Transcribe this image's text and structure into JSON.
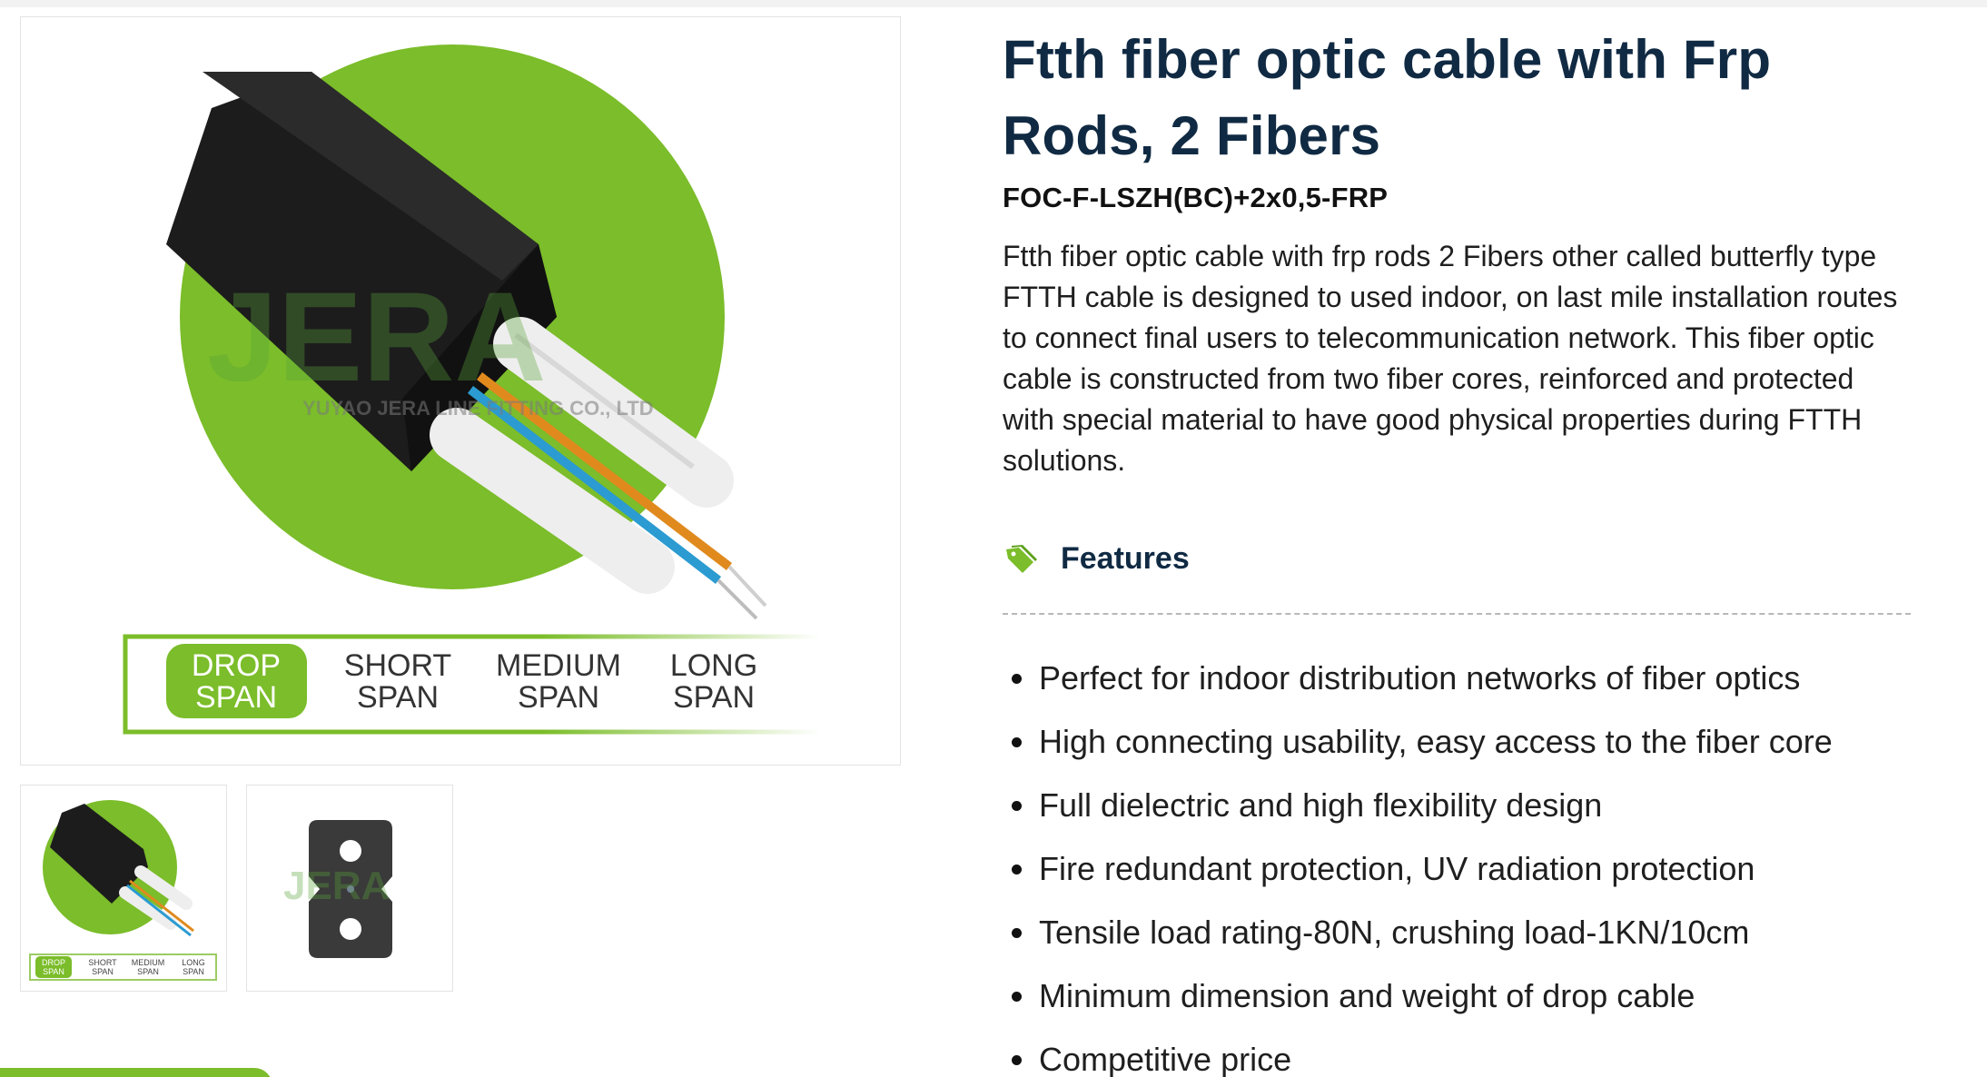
{
  "product": {
    "title": "Ftth fiber optic cable with Frp Rods, 2 Fibers",
    "model": "FOC-F-LSZH(BC)+2x0,5-FRP",
    "description": "Ftth fiber optic cable with frp rods 2 Fibers other called butterfly type FTTH cable is designed to used indoor, on last mile installation routes to connect final users to telecommunication network. This fiber optic cable is constructed from two fiber cores, reinforced and protected with special material to have good physical properties during FTTH solutions."
  },
  "image": {
    "watermark_brand": "JERA",
    "watermark_sub": "YUYAO JERA LINE FITTING CO., LTD",
    "span_options": [
      {
        "line1": "DROP",
        "line2": "SPAN",
        "active": true
      },
      {
        "line1": "SHORT",
        "line2": "SPAN",
        "active": false
      },
      {
        "line1": "MEDIUM",
        "line2": "SPAN",
        "active": false
      },
      {
        "line1": "LONG",
        "line2": "SPAN",
        "active": false
      }
    ]
  },
  "features": {
    "heading": "Features",
    "icon": "tag-icon",
    "items": [
      "Perfect for indoor distribution networks of fiber optics",
      "High connecting usability, easy access to the fiber core",
      "Full dielectric and high flexibility design",
      "Fire redundant protection, UV radiation protection",
      "Tensile load rating-80N, crushing load-1KN/10cm",
      "Minimum dimension and weight of drop cable",
      "Competitive price"
    ]
  },
  "colors": {
    "brand_green": "#7bbd2a",
    "title_navy": "#102a43",
    "cable_black": "#1a1a1a"
  }
}
